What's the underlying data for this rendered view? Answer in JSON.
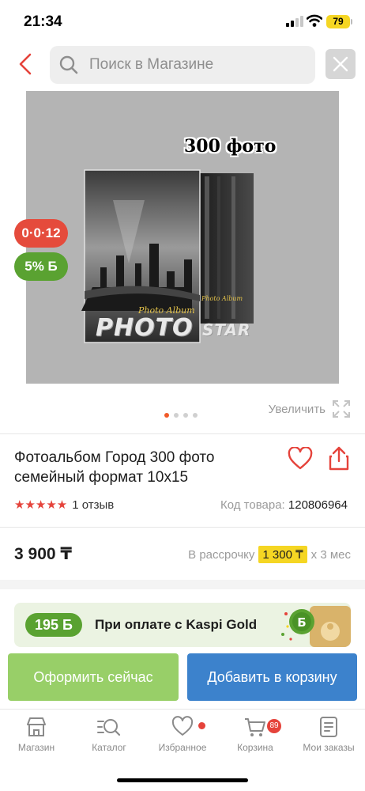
{
  "status_bar": {
    "time": "21:34",
    "battery": "79"
  },
  "header": {
    "search_placeholder": "Поиск в Магазине"
  },
  "product": {
    "image_caption": "300 фото",
    "image_book_title": "Photo Album",
    "image_brand_main": "PHOTO",
    "image_brand_sub": "STAR",
    "installment_badge": "0·0·12",
    "bonus_badge": "5% Б",
    "zoom_label": "Увеличить",
    "title": "Фотоальбом Город 300 фото семейный формат 10х15",
    "rating_stars": 5,
    "reviews": "1 отзыв",
    "sku_label": "Код товара:",
    "sku_value": "120806964",
    "price": "3 900 ₸",
    "installment_prefix": "В рассрочку",
    "installment_amount": "1 300 ₸",
    "installment_suffix": "х 3 мес",
    "gallery_total": 4,
    "gallery_active": 1
  },
  "kaspi_gold": {
    "bonus": "195 Б",
    "text": "При оплате с Kaspi Gold"
  },
  "actions": {
    "buy_now": "Оформить сейчас",
    "add_to_cart": "Добавить в корзину"
  },
  "tabs": [
    {
      "label": "Магазин",
      "icon": "shop-icon"
    },
    {
      "label": "Каталог",
      "icon": "catalog-search-icon"
    },
    {
      "label": "Избранное",
      "icon": "heart-icon"
    },
    {
      "label": "Корзина",
      "icon": "cart-icon",
      "badge": "89"
    },
    {
      "label": "Мои заказы",
      "icon": "orders-icon"
    }
  ],
  "colors": {
    "accent_red": "#e5433b",
    "bonus_green": "#5aa231",
    "buy_green": "#98cf68",
    "cart_blue": "#3c82cc",
    "installment_yellow": "#f5d623"
  }
}
